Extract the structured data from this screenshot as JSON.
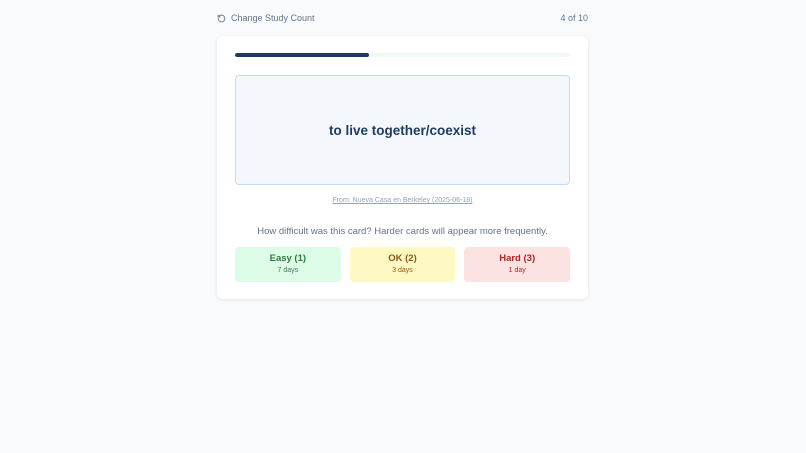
{
  "header": {
    "change_count_label": "Change Study Count",
    "progress_text": "4 of 10"
  },
  "progress": {
    "current": 4,
    "total": 10
  },
  "card": {
    "text": "to live together/coexist",
    "source": "From: Nueva Casa en Berkeley (2025-06-18)"
  },
  "question": "How difficult was this card? Harder cards will appear more frequently.",
  "ratings": [
    {
      "label": "Easy (1)",
      "interval": "7 days"
    },
    {
      "label": "OK (2)",
      "interval": "3 days"
    },
    {
      "label": "Hard (3)",
      "interval": "1 day"
    }
  ],
  "icons": {
    "change_count": "refresh-icon"
  },
  "colors": {
    "progress_fill": "#1e3a5f",
    "easy_bg": "#dcfce7",
    "ok_bg": "#fef9c3",
    "hard_bg": "#fde2e2"
  }
}
